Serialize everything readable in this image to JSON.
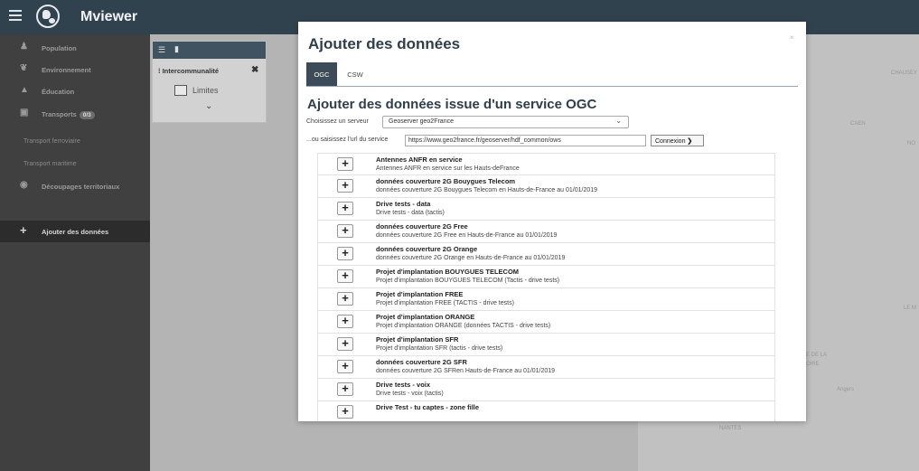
{
  "app": {
    "title": "Mviewer"
  },
  "sidebar": {
    "items": [
      {
        "label": "Population",
        "icon": "people-icon"
      },
      {
        "label": "Environnement",
        "icon": "leaf-icon"
      },
      {
        "label": "Éducation",
        "icon": "graduation-cap-icon"
      },
      {
        "label": "Transports",
        "icon": "bus-icon",
        "badge": "0/3"
      },
      {
        "label": "Découpages territoriaux",
        "icon": "globe-icon"
      }
    ],
    "subitems": [
      "Transport ferroviaire",
      "Transport maritime"
    ],
    "add_data_label": "Ajouter des données"
  },
  "layer_panel": {
    "title": "Intercommunalité",
    "checkbox_label": "Limites"
  },
  "map": {
    "labels": [
      "CHAUSEY",
      "CAEN",
      "NO",
      "LE M",
      "E DE LA",
      "OIRE",
      "Angers",
      "NANTES"
    ]
  },
  "modal": {
    "title": "Ajouter des données",
    "close_label": "×",
    "tabs": [
      "OGC",
      "CSW"
    ],
    "subtitle": "Ajouter des données issue d'un service OGC",
    "server_label": "Choisissez un serveur",
    "server_value": "Geoserver geo2France",
    "url_label": "...ou saisissez l'url du service",
    "url_value": "https://www.geo2france.fr/geoserver/hdf_common/ows",
    "connexion_label": "Connexion",
    "add_symbol": "+",
    "layers": [
      {
        "title": "Antennes ANFR en service",
        "desc": "Antennes ANFR en service sur les Hauts-deFrance"
      },
      {
        "title": "données couverture 2G Bouygues Telecom",
        "desc": "données couverture 2G Bouygues Telecom en Hauts-de-France au 01/01/2019"
      },
      {
        "title": "Drive tests - data",
        "desc": "Drive tests - data (tactis)"
      },
      {
        "title": "données couverture 2G Free",
        "desc": "données couverture 2G Free en Hauts-de-France au 01/01/2019"
      },
      {
        "title": "données couverture 2G Orange",
        "desc": "données couverture 2G Orange en Hauts-de-France au 01/01/2019"
      },
      {
        "title": "Projet d'implantation BOUYGUES TELECOM",
        "desc": "Projet d'implantation BOUYGUES TELECOM (Tactis - drive tests)"
      },
      {
        "title": "Projet d'implantation FREE",
        "desc": "Projet d'implantation FREE (TACTIS - drive tests)"
      },
      {
        "title": "Projet d'implantation ORANGE",
        "desc": "Projet d'implantation ORANGE (données TACTIS - drive tests)"
      },
      {
        "title": "Projet d'implantation SFR",
        "desc": "Projet d'implantation SFR (tactis - drive tests)"
      },
      {
        "title": "données couverture 2G SFR",
        "desc": "données couverture 2G SFRen Hauts-de-France au 01/01/2019"
      },
      {
        "title": "Drive tests - voix",
        "desc": "Drive tests - voix (tactis)"
      },
      {
        "title": "Drive Test - tu captes - zone fille",
        "desc": ""
      }
    ]
  }
}
